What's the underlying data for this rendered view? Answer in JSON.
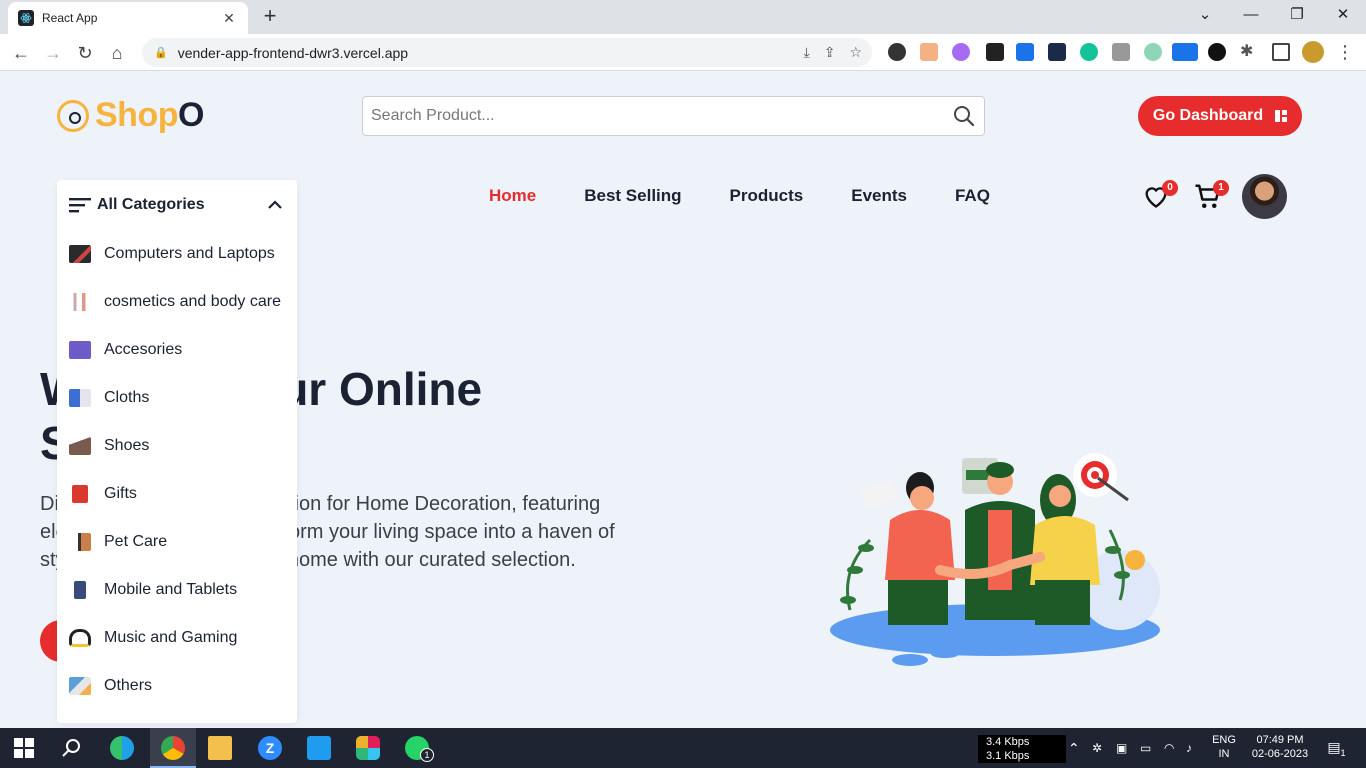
{
  "browser": {
    "tab_title": "React App",
    "url": "vender-app-frontend-dwr3.vercel.app"
  },
  "header": {
    "logo_main": "Shop",
    "logo_accent": "O",
    "search_placeholder": "Search Product...",
    "dashboard_button": "Go Dashboard"
  },
  "nav": {
    "items": [
      "Home",
      "Best Selling",
      "Products",
      "Events",
      "FAQ"
    ],
    "active": "Home",
    "wishlist_count": "0",
    "cart_count": "1"
  },
  "hero": {
    "title_line1": "W          o our Online",
    "title_line2": "S",
    "text_line1": "Di                                  ollection for Home Decoration, featuring",
    "text_line2": "ele                               transform your living space into a haven of",
    "text_line3": "sty                          ate your home with our curated selection."
  },
  "categories": {
    "title": "All Categories",
    "items": [
      "Computers and Laptops",
      "cosmetics and body care",
      "Accesories",
      "Cloths",
      "Shoes",
      "Gifts",
      "Pet Care",
      "Mobile and Tablets",
      "Music and Gaming",
      "Others"
    ]
  },
  "taskbar": {
    "download_speed": "3.4 Kbps",
    "upload_speed": "3.1 Kbps",
    "lang1": "ENG",
    "lang2": "IN",
    "time": "07:49 PM",
    "date": "02-06-2023",
    "notifications": "1",
    "whatsapp_badge": "1"
  },
  "colors": {
    "accent": "#e62c2c",
    "logo": "#f6b33e",
    "dark": "#1b2233",
    "background": "#eef2f9"
  }
}
